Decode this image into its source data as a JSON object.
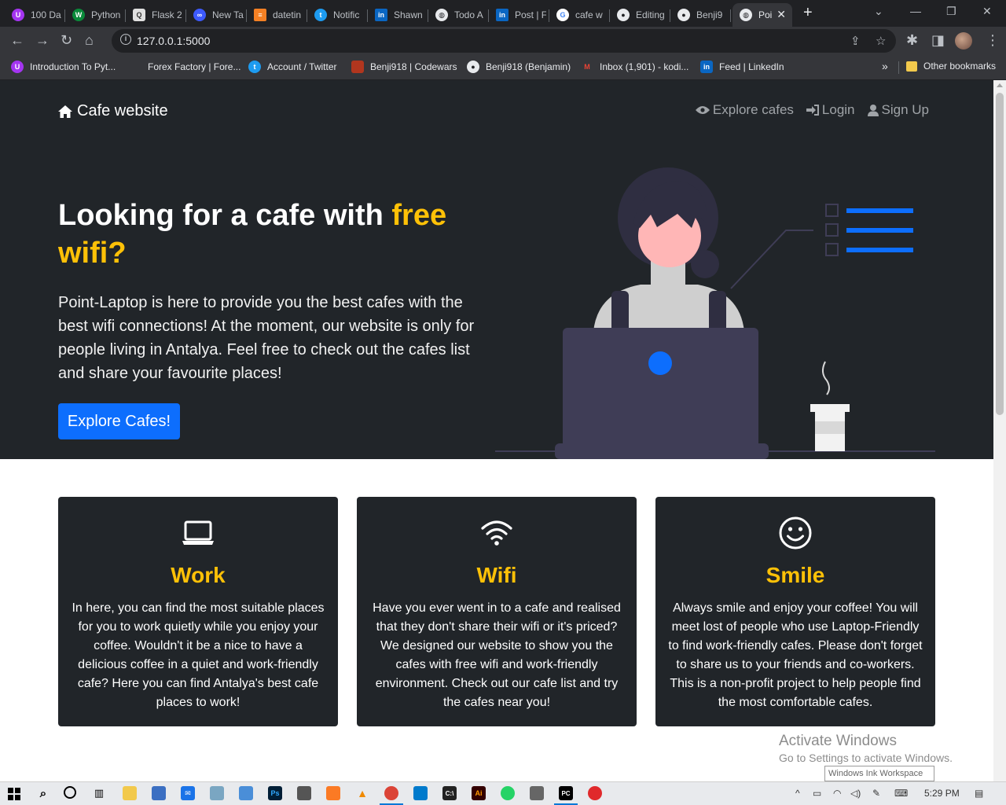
{
  "browser": {
    "tabs": [
      {
        "title": "100 Da",
        "icon": "udemy-icon",
        "color": "#a435f0"
      },
      {
        "title": "Python",
        "icon": "w3-icon",
        "color": "#0a8a3a"
      },
      {
        "title": "Flask 2",
        "icon": "magnifier-doc-icon",
        "color": "#e0e0e0"
      },
      {
        "title": "New Ta",
        "icon": "meta-icon",
        "color": "#3d5afe"
      },
      {
        "title": "datetin",
        "icon": "stackoverflow-icon",
        "color": "#f48024"
      },
      {
        "title": "Notific",
        "icon": "twitter-icon",
        "color": "#1d9bf0"
      },
      {
        "title": "Shawn",
        "icon": "linkedin-icon",
        "color": "#0a66c2"
      },
      {
        "title": "Todo A",
        "icon": "globe-icon",
        "color": "#e8eaed"
      },
      {
        "title": "Post | F",
        "icon": "linkedin-icon",
        "color": "#0a66c2"
      },
      {
        "title": "cafe w",
        "icon": "google-icon",
        "color": "#ffffff"
      },
      {
        "title": "Editing",
        "icon": "github-icon",
        "color": "#e8eaed"
      },
      {
        "title": "Benji9",
        "icon": "github-icon",
        "color": "#e8eaed"
      },
      {
        "title": "Poi",
        "icon": "globe-icon",
        "color": "#e8eaed"
      }
    ],
    "url": "127.0.0.1:5000",
    "bookmarks": [
      {
        "label": "Introduction To Pyt...",
        "icon": "udemy-icon",
        "color": "#a435f0"
      },
      {
        "label": "Forex Factory | Fore...",
        "icon": "forex-icon",
        "color": "#35363a"
      },
      {
        "label": "Account / Twitter",
        "icon": "twitter-icon",
        "color": "#1d9bf0"
      },
      {
        "label": "Benji918 | Codewars",
        "icon": "codewars-icon",
        "color": "#b1361e"
      },
      {
        "label": "Benji918 (Benjamin)",
        "icon": "github-icon",
        "color": "#35363a"
      },
      {
        "label": "Inbox (1,901) - kodi...",
        "icon": "gmail-icon",
        "color": "#35363a"
      },
      {
        "label": "Feed | LinkedIn",
        "icon": "linkedin-icon",
        "color": "#0a66c2"
      }
    ],
    "bookmarks_more": "»",
    "other_bookmarks": "Other bookmarks"
  },
  "site": {
    "brand": "Cafe website",
    "nav": {
      "explore": "Explore cafes",
      "login": "Login",
      "signup": "Sign Up"
    },
    "hero": {
      "title_start": "Looking for a cafe with ",
      "title_highlight": "free wifi?",
      "lead": "Point-Laptop is here to provide you the best cafes with the best wifi connections! At the moment, our website is only for people living in Antalya. Feel free to check out the cafes list and share your favourite places!",
      "button": "Explore Cafes!"
    },
    "features": [
      {
        "icon": "laptop-icon",
        "title": "Work",
        "text": "In here, you can find the most suitable places for you to work quietly while you enjoy your coffee. Wouldn't it be a nice to have a delicious coffee in a quiet and work-friendly cafe? Here you can find Antalya's best cafe places to work!"
      },
      {
        "icon": "wifi-icon",
        "title": "Wifi",
        "text": "Have you ever went in to a cafe and realised that they don't share their wifi or it's priced? We designed our website to show you the cafes with free wifi and work-friendly environment. Check out our cafe list and try the cafes near you!"
      },
      {
        "icon": "smile-icon",
        "title": "Smile",
        "text": "Always smile and enjoy your coffee! You will meet lost of people who use Laptop-Friendly to find work-friendly cafes. Please don't forget to share us to your friends and co-workers. This is a non-profit project to help people find the most comfortable cafes."
      }
    ],
    "colors": {
      "accent": "#ffc107",
      "primary": "#0d6efd",
      "dark": "#212529"
    }
  },
  "os": {
    "watermark_title": "Activate Windows",
    "watermark_sub": "Go to Settings to activate Windows.",
    "ink_tooltip": "Windows Ink Workspace",
    "clock": "5:29 PM"
  }
}
